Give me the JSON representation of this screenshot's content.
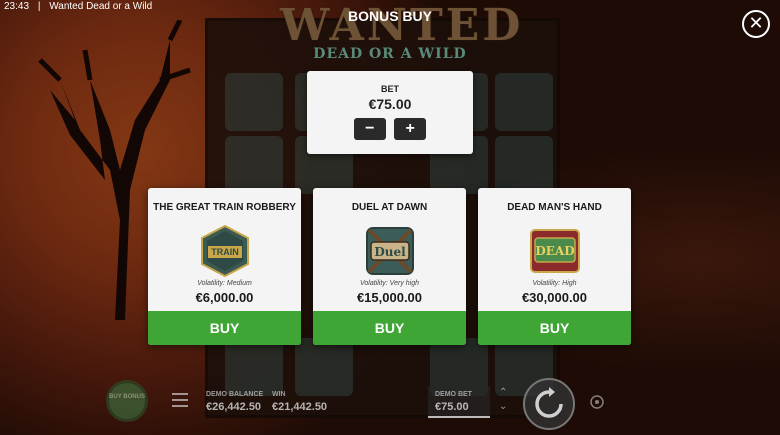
{
  "status_bar": {
    "time": "23:43",
    "separator": "|",
    "title": "Wanted Dead or a Wild"
  },
  "logo": {
    "line1": "WANTED",
    "line2": "DEAD OR A WILD"
  },
  "header": {
    "title": "BONUS BUY",
    "close_icon": "close-icon"
  },
  "bet": {
    "label": "BET",
    "value": "€75.00",
    "minus_label": "−",
    "plus_label": "+"
  },
  "cards": [
    {
      "title": "THE GREAT TRAIN ROBBERY",
      "icon_text": "TRAIN",
      "volatility": "Volatility: Medium",
      "price": "€6,000.00",
      "buy_label": "BUY",
      "icon": "train-robbery-icon"
    },
    {
      "title": "DUEL AT DAWN",
      "icon_text": "Duel",
      "volatility": "Volatility: Very high",
      "price": "€15,000.00",
      "buy_label": "BUY",
      "icon": "duel-icon"
    },
    {
      "title": "DEAD MAN'S HAND",
      "icon_text": "DEAD",
      "volatility": "Volatility: High",
      "price": "€30,000.00",
      "buy_label": "BUY",
      "icon": "dead-mans-hand-icon"
    }
  ],
  "bottom_bar": {
    "buy_bonus_label": "BUY BONUS",
    "demo_balance_label": "DEMO BALANCE",
    "demo_balance_value": "€26,442.50",
    "win_label": "WIN",
    "win_value": "€21,442.50",
    "demo_bet_label": "DEMO BET",
    "demo_bet_value": "€75.00"
  },
  "colors": {
    "buy_green": "#3fa535",
    "panel_bg": "#f4f4f4",
    "dark_button": "#2a2a2a"
  }
}
